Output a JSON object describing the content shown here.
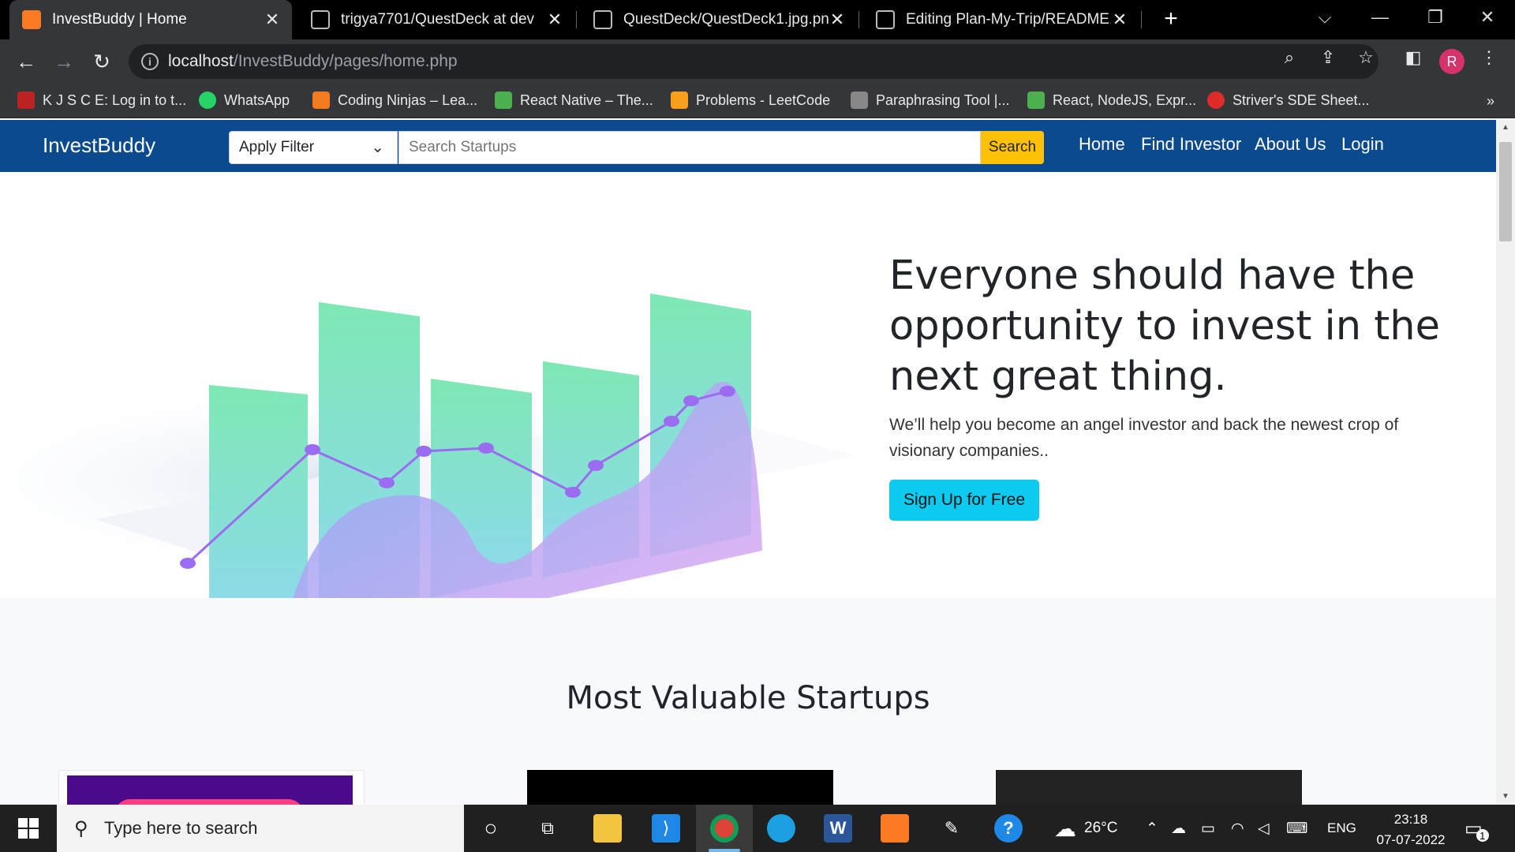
{
  "browser": {
    "tabs": [
      {
        "title": "InvestBuddy | Home",
        "active": true
      },
      {
        "title": "trigya7701/QuestDeck at dev",
        "active": false
      },
      {
        "title": "QuestDeck/QuestDeck1.jpg.png",
        "active": false
      },
      {
        "title": "Editing Plan-My-Trip/README.m",
        "active": false
      }
    ],
    "url_host": "localhost",
    "url_path": "/InvestBuddy/pages/home.php",
    "profile_initial": "R",
    "bookmarks": [
      {
        "label": "K J S C E: Log in to t..."
      },
      {
        "label": "WhatsApp"
      },
      {
        "label": "Coding Ninjas – Lea..."
      },
      {
        "label": "React Native – The..."
      },
      {
        "label": "Problems - LeetCode"
      },
      {
        "label": "Paraphrasing Tool |..."
      },
      {
        "label": "React, NodeJS, Expr..."
      },
      {
        "label": "Striver's SDE Sheet..."
      }
    ],
    "bookmarks_more": "»"
  },
  "site": {
    "brand": "InvestBuddy",
    "filter": {
      "selected": "Apply Filter"
    },
    "search": {
      "placeholder": "Search Startups",
      "button": "Search"
    },
    "nav": [
      "Home",
      "Find Investor",
      "About Us",
      "Login"
    ],
    "hero": {
      "title": "Everyone should have the opportunity to invest in the next great thing.",
      "subtitle": "We’ll help you become an angel investor and back the newest crop of visionary companies..",
      "cta": "Sign Up for Free"
    },
    "section_title": "Most Valuable Startups"
  },
  "taskbar": {
    "search_placeholder": "Type here to search",
    "weather": "26°C",
    "language": "ENG",
    "time": "23:18",
    "date": "07-07-2022",
    "notification_count": "1"
  },
  "colors": {
    "site_nav": "#0b4a8f",
    "search_button": "#ffc107",
    "cta": "#0dcaf0"
  }
}
